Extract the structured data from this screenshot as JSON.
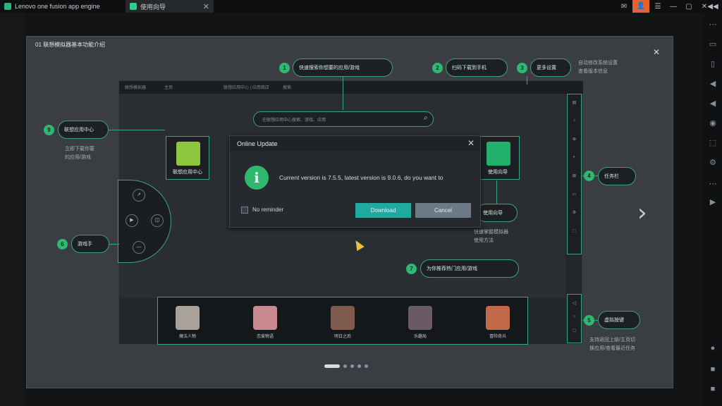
{
  "titlebar": {
    "app_tab": "Lenovo one fusion app engine",
    "active_tab": "使用向导",
    "close": "✕"
  },
  "window_controls": [
    "✉",
    "☰",
    "—",
    "▢",
    "✕",
    "◀◀"
  ],
  "guide": {
    "title": "01 联想模拟器基本功能介绍",
    "close": "✕",
    "next": "›",
    "callouts": [
      {
        "num": "1",
        "label": "快速搜索你想要的应用/游戏"
      },
      {
        "num": "2",
        "label": "扫码下载到手机"
      },
      {
        "num": "3",
        "label": "更多设置"
      },
      {
        "num": "4",
        "label": "任务栏"
      },
      {
        "num": "5",
        "label": "虚拟按键"
      },
      {
        "num": "6",
        "label": "游戏手"
      },
      {
        "num": "7",
        "label": "为你推荐热门应用/游戏"
      },
      {
        "num": "8",
        "label": "使用向导"
      },
      {
        "num": "9",
        "label": "联想应用中心"
      }
    ],
    "desc_3": "自动修改系统设置\n查看版本信息",
    "desc_9": "立即下载你要\n的应用/游戏",
    "desc_8": "快速掌握模拟器\n使用方法",
    "desc_5": "支持返回上级/主页切\n换应用/查看最近任务"
  },
  "shot": {
    "tab1": "联想模拟器",
    "tab2": "主页",
    "tab3": "联想应用中心 | 应用商店",
    "tab4": "搜索",
    "search_placeholder": "在联想应用中心搜索、游戏、应用",
    "tile_center": "联想应用中心",
    "tile_guide": "使用向导",
    "games": [
      "魔法人物",
      "恋爱物语",
      "明日之后",
      "乐趣局",
      "冒险奇兵"
    ],
    "toolbar_icons": [
      "▤",
      "♪",
      "⊕",
      "◐",
      "⊠",
      "▭",
      "⚙",
      "⬚"
    ],
    "nav_icons": [
      "◁",
      "○",
      "□"
    ]
  },
  "dialog": {
    "title": "Online Update",
    "close": "✕",
    "message": "Current version is 7.5.5, latest version is 9.0.6, do you want to",
    "no_reminder": "No reminder",
    "download": "Download",
    "cancel": "Cancel"
  },
  "rightbar_icons": [
    "⋯",
    "▭",
    "▯",
    "◀",
    "◀",
    "◉",
    "⬚",
    "⚙",
    "⋯",
    "▶",
    "●",
    "■"
  ]
}
